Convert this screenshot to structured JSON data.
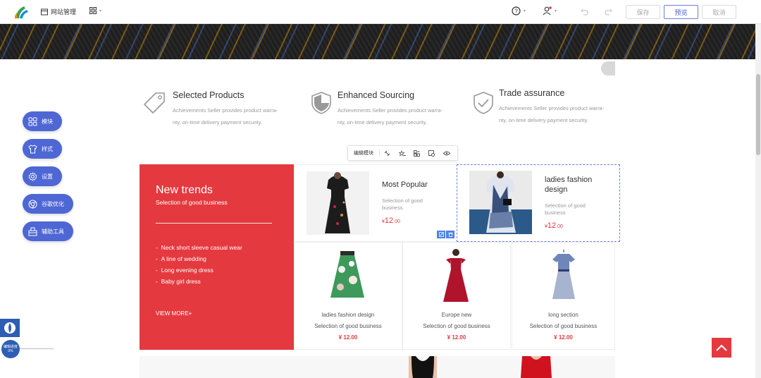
{
  "topbar": {
    "site_manage": "网站管理",
    "save": "保存",
    "preview": "预览",
    "cancel": "取消"
  },
  "features": [
    {
      "title": "Selected Products",
      "desc": "Achievements Seller provides product warra-nty, on-time delivery payment security.",
      "icon": "tag-icon"
    },
    {
      "title": "Enhanced Sourcing",
      "desc": "Achievements Seller provides product warra-nty, on-time delivery payment security.",
      "icon": "shield-icon"
    },
    {
      "title": "Trade assurance",
      "desc": "Achievements Seller provides product warra-nty, on-time delivery payment security.",
      "icon": "shield-check-icon"
    }
  ],
  "side_nav": [
    {
      "label": "模块",
      "icon": "grid-icon"
    },
    {
      "label": "样式",
      "icon": "shirt-icon"
    },
    {
      "label": "设置",
      "icon": "gear-icon"
    },
    {
      "label": "谷歌优化",
      "icon": "chrome-icon"
    },
    {
      "label": "辅助工具",
      "icon": "toolbox-icon"
    }
  ],
  "module_toolbar": {
    "label": "编辑模块"
  },
  "trend_panel": {
    "title": "New trends",
    "subtitle": "Selection of good business",
    "items": [
      "Neck short sleeve casual wear",
      "A line of wedding",
      "Long evening dress",
      "Baby girl dress"
    ],
    "more": "VIEW MORE+"
  },
  "big_products": [
    {
      "name": "Most Popular",
      "sub": "Selection of good business",
      "currency": "¥",
      "price": "12",
      "cents": ".00"
    },
    {
      "name": "ladies fashion design",
      "sub": "Selection of good business",
      "currency": "¥",
      "price": "12",
      "cents": ".00"
    }
  ],
  "small_products": [
    {
      "name": "ladies fashion design",
      "sub": "Selection of good business",
      "price": "¥ 12.00"
    },
    {
      "name": "Europe new",
      "sub": "Selection of good business",
      "price": "¥ 12.00"
    },
    {
      "name": "long section",
      "sub": "Selection of good business",
      "price": "¥ 12.00"
    }
  ],
  "left_widget": {
    "label": "编辑进度",
    "percent": "0%"
  },
  "colors": {
    "accent": "#4e67d4",
    "red": "#e43a3f"
  }
}
